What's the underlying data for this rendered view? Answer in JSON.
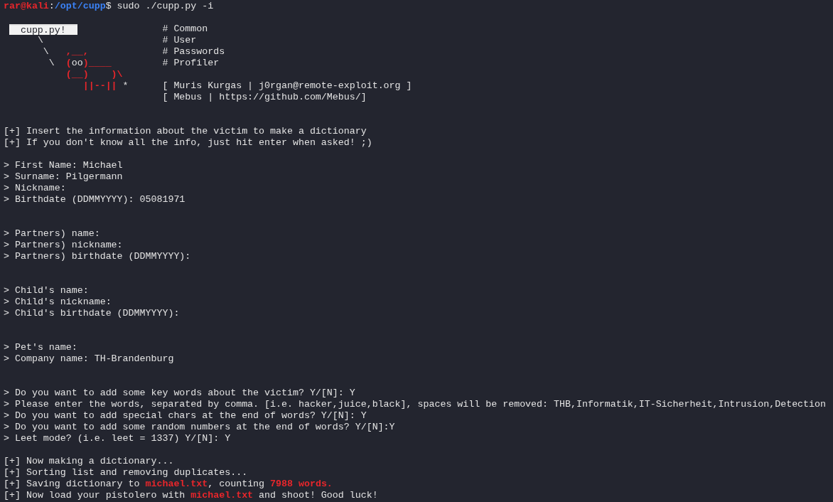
{
  "terminal": {
    "lines": [
      {
        "kind": "text",
        "segments": [
          {
            "kind": "user",
            "text": "rar@kali"
          },
          {
            "kind": "plain",
            "text": ":"
          },
          {
            "kind": "path",
            "text": "/opt/cupp"
          },
          {
            "kind": "plain",
            "text": "$ sudo ./cupp.py -i"
          }
        ]
      },
      {
        "kind": "blank"
      },
      {
        "kind": "banner",
        "banner": {
          "label": "cupp.py!",
          "art_lines": [
            [
              {
                "kind": "plain",
                "text": "      \\"
              }
            ],
            [
              {
                "kind": "plain",
                "text": "       \\   "
              },
              {
                "kind": "highlight",
                "text": ",__,"
              }
            ],
            [
              {
                "kind": "plain",
                "text": "        \\  "
              },
              {
                "kind": "highlight",
                "text": "("
              },
              {
                "kind": "plain",
                "text": "oo"
              },
              {
                "kind": "highlight",
                "text": ")____"
              }
            ],
            [
              {
                "kind": "highlight",
                "text": "           (__)    )\\"
              }
            ],
            [
              {
                "kind": "highlight",
                "text": "              ||--||"
              },
              {
                "kind": "plain",
                "text": " *"
              }
            ]
          ],
          "info_lines": [
            {
              "kind": "text",
              "text": "# Common"
            },
            {
              "kind": "text",
              "text": "# User"
            },
            {
              "kind": "text",
              "text": "# Passwords"
            },
            {
              "kind": "text",
              "text": "# Profiler"
            },
            {
              "kind": "blank"
            },
            {
              "kind": "text",
              "text": "[ Muris Kurgas | j0rgan@remote-exploit.org ]"
            },
            {
              "kind": "text",
              "text": "[ Mebus | https://github.com/Mebus/]"
            }
          ]
        }
      },
      {
        "kind": "blank"
      },
      {
        "kind": "blank"
      },
      {
        "kind": "text",
        "segments": [
          {
            "kind": "plain",
            "text": "[+] Insert the information about the victim to make a dictionary"
          }
        ]
      },
      {
        "kind": "text",
        "segments": [
          {
            "kind": "plain",
            "text": "[+] If you don't know all the info, just hit enter when asked! ;)"
          }
        ]
      },
      {
        "kind": "blank"
      },
      {
        "kind": "text",
        "segments": [
          {
            "kind": "plain",
            "text": "> First Name: Michael"
          }
        ]
      },
      {
        "kind": "text",
        "segments": [
          {
            "kind": "plain",
            "text": "> Surname: Pilgermann"
          }
        ]
      },
      {
        "kind": "text",
        "segments": [
          {
            "kind": "plain",
            "text": "> Nickname:"
          }
        ]
      },
      {
        "kind": "text",
        "segments": [
          {
            "kind": "plain",
            "text": "> Birthdate (DDMMYYYY): 05081971"
          }
        ]
      },
      {
        "kind": "blank"
      },
      {
        "kind": "blank"
      },
      {
        "kind": "text",
        "segments": [
          {
            "kind": "plain",
            "text": "> Partners) name:"
          }
        ]
      },
      {
        "kind": "text",
        "segments": [
          {
            "kind": "plain",
            "text": "> Partners) nickname:"
          }
        ]
      },
      {
        "kind": "text",
        "segments": [
          {
            "kind": "plain",
            "text": "> Partners) birthdate (DDMMYYYY):"
          }
        ]
      },
      {
        "kind": "blank"
      },
      {
        "kind": "blank"
      },
      {
        "kind": "text",
        "segments": [
          {
            "kind": "plain",
            "text": "> Child's name:"
          }
        ]
      },
      {
        "kind": "text",
        "segments": [
          {
            "kind": "plain",
            "text": "> Child's nickname:"
          }
        ]
      },
      {
        "kind": "text",
        "segments": [
          {
            "kind": "plain",
            "text": "> Child's birthdate (DDMMYYYY):"
          }
        ]
      },
      {
        "kind": "blank"
      },
      {
        "kind": "blank"
      },
      {
        "kind": "text",
        "segments": [
          {
            "kind": "plain",
            "text": "> Pet's name:"
          }
        ]
      },
      {
        "kind": "text",
        "segments": [
          {
            "kind": "plain",
            "text": "> Company name: TH-Brandenburg"
          }
        ]
      },
      {
        "kind": "blank"
      },
      {
        "kind": "blank"
      },
      {
        "kind": "text",
        "segments": [
          {
            "kind": "plain",
            "text": "> Do you want to add some key words about the victim? Y/[N]: Y"
          }
        ]
      },
      {
        "kind": "text",
        "segments": [
          {
            "kind": "plain",
            "text": "> Please enter the words, separated by comma. [i.e. hacker,juice,black], spaces will be removed: THB,Informatik,IT-Sicherheit,Intrusion,Detection"
          }
        ]
      },
      {
        "kind": "text",
        "segments": [
          {
            "kind": "plain",
            "text": "> Do you want to add special chars at the end of words? Y/[N]: Y"
          }
        ]
      },
      {
        "kind": "text",
        "segments": [
          {
            "kind": "plain",
            "text": "> Do you want to add some random numbers at the end of words? Y/[N]:Y"
          }
        ]
      },
      {
        "kind": "text",
        "segments": [
          {
            "kind": "plain",
            "text": "> Leet mode? (i.e. leet = 1337) Y/[N]: Y"
          }
        ]
      },
      {
        "kind": "blank"
      },
      {
        "kind": "text",
        "segments": [
          {
            "kind": "plain",
            "text": "[+] Now making a dictionary..."
          }
        ]
      },
      {
        "kind": "text",
        "segments": [
          {
            "kind": "plain",
            "text": "[+] Sorting list and removing duplicates..."
          }
        ]
      },
      {
        "kind": "text",
        "segments": [
          {
            "kind": "plain",
            "text": "[+] Saving dictionary to "
          },
          {
            "kind": "highlight",
            "text": "michael.txt"
          },
          {
            "kind": "plain",
            "text": ", counting "
          },
          {
            "kind": "highlight",
            "text": "7988 words."
          }
        ]
      },
      {
        "kind": "text",
        "segments": [
          {
            "kind": "plain",
            "text": "[+] Now load your pistolero with "
          },
          {
            "kind": "highlight",
            "text": "michael.txt"
          },
          {
            "kind": "plain",
            "text": " and shoot! Good luck!"
          }
        ]
      }
    ]
  }
}
